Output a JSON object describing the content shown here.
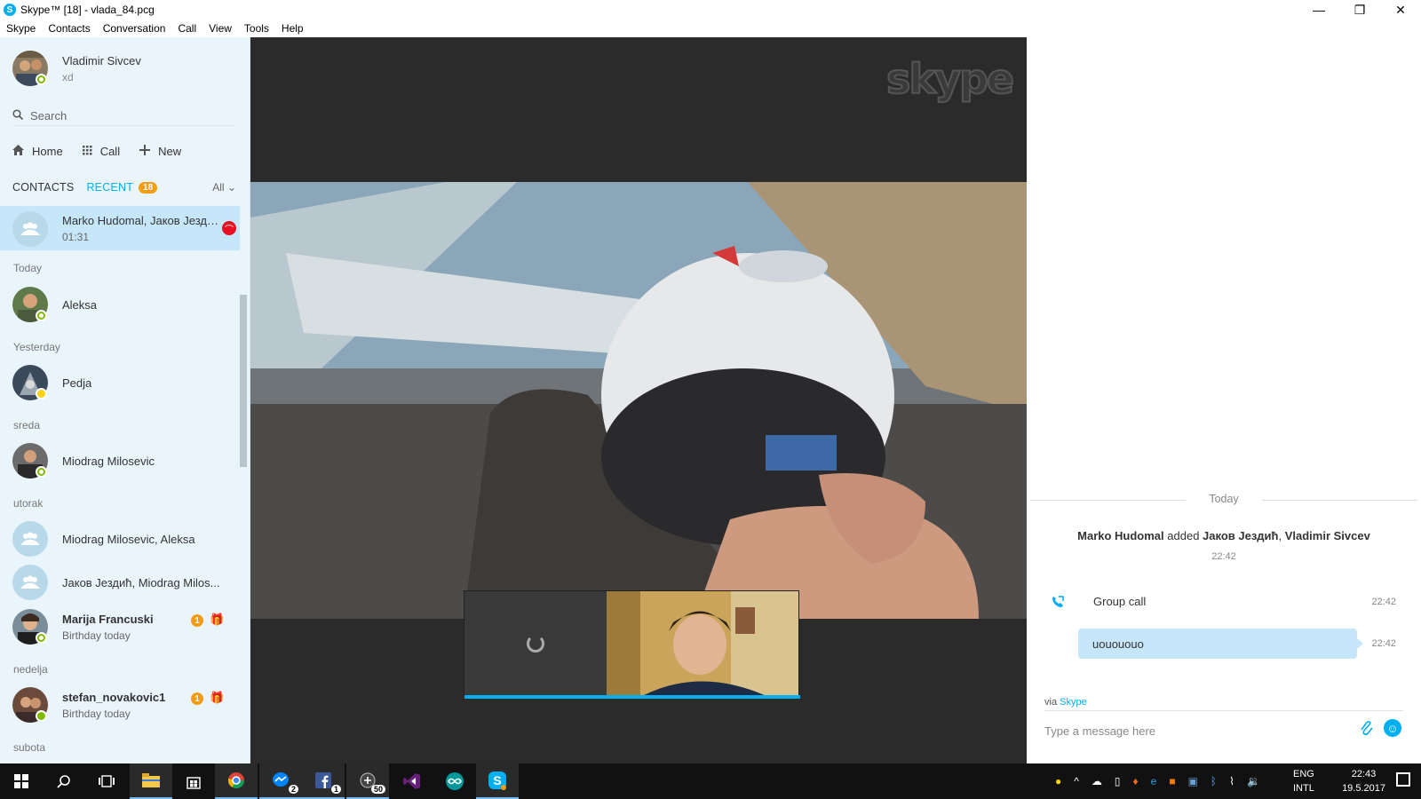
{
  "window": {
    "title": "Skype™ [18] - vlada_84.pcg",
    "app_icon": "S",
    "controls": [
      "—",
      "❐",
      "✕"
    ]
  },
  "menu": [
    "Skype",
    "Contacts",
    "Conversation",
    "Call",
    "View",
    "Tools",
    "Help"
  ],
  "profile": {
    "name": "Vladimir Sivcev",
    "mood": "xd"
  },
  "search": {
    "placeholder": "Search"
  },
  "nav": {
    "home": "Home",
    "call": "Call",
    "new": "New"
  },
  "tabs": {
    "contacts": "CONTACTS",
    "recent": "RECENT",
    "recent_count": "18",
    "filter": "All"
  },
  "active_conversation": {
    "name": "Marko Hudomal, Јаков Јездић...",
    "duration": "01:31"
  },
  "sections": {
    "today": "Today",
    "yesterday": "Yesterday",
    "sreda": "sreda",
    "utorak": "utorak",
    "nedelja": "nedelja",
    "subota": "subota"
  },
  "contacts": {
    "aleksa": {
      "name": "Aleksa"
    },
    "pedja": {
      "name": "Pedja"
    },
    "miodrag": {
      "name": "Miodrag Milosevic"
    },
    "group1": {
      "name": "Miodrag Milosevic, Aleksa"
    },
    "group2": {
      "name": "Јаков Јездић, Miodrag Milos..."
    },
    "marija": {
      "name": "Marija Francuski",
      "sub": "Birthday today",
      "badge": "1"
    },
    "stefan": {
      "name": "stefan_novakovic1",
      "sub": "Birthday today",
      "badge": "1"
    }
  },
  "video": {
    "logo": "skype"
  },
  "chat": {
    "date_divider": "Today",
    "system": {
      "actor": "Marko Hudomal",
      "verb": " added ",
      "target1": "Јаков Јездић",
      "sep": ", ",
      "target2": "Vladimir Sivcev",
      "time": "22:42"
    },
    "call": {
      "label": "Group call",
      "time": "22:42"
    },
    "message": {
      "text": "uouououo",
      "time": "22:42"
    },
    "via_prefix": "via ",
    "via_link": "Skype",
    "compose_placeholder": "Type a message here"
  },
  "taskbar": {
    "messenger_count": "2",
    "facebook_count": "1",
    "app_count": "50",
    "lang_top": "ENG",
    "lang_bottom": "INTL",
    "time": "22:43",
    "date": "19.5.2017"
  },
  "colors": {
    "accent": "#00aff0",
    "sidebar_bg": "#eaf5fb",
    "active_row": "#c6e7f9",
    "badge_orange": "#f39c12",
    "hangup_red": "#e81123",
    "online_green": "#7fba00"
  }
}
